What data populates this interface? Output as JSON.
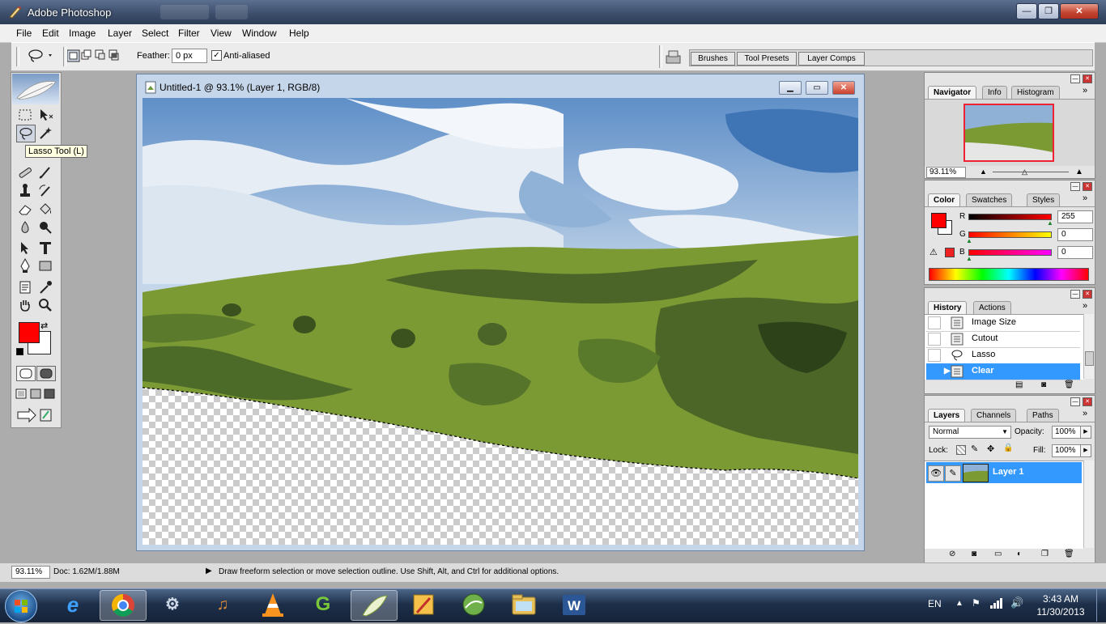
{
  "window": {
    "title": "Adobe Photoshop",
    "buttons": {
      "minimize": "—",
      "restore": "❐",
      "close": "✕"
    }
  },
  "menu": [
    "File",
    "Edit",
    "Image",
    "Layer",
    "Select",
    "Filter",
    "View",
    "Window",
    "Help"
  ],
  "options": {
    "feather_label": "Feather:",
    "feather_value": "0 px",
    "antialiased_label": "Anti-aliased",
    "antialiased_checked": true,
    "dock_tabs": [
      "Brushes",
      "Tool Presets",
      "Layer Comps"
    ]
  },
  "toolbox": {
    "tooltip": "Lasso Tool (L)",
    "foreground_color": "#ff0000",
    "background_color": "#ffffff"
  },
  "document": {
    "title": "Untitled-1 @ 93.1% (Layer 1, RGB/8)"
  },
  "navigator": {
    "tabs": [
      "Navigator",
      "Info",
      "Histogram"
    ],
    "zoom": "93.11%"
  },
  "color_panel": {
    "tabs": [
      "Color",
      "Swatches",
      "Styles"
    ],
    "channels": [
      {
        "label": "R",
        "value": "255"
      },
      {
        "label": "G",
        "value": "0"
      },
      {
        "label": "B",
        "value": "0"
      }
    ]
  },
  "history": {
    "tabs": [
      "History",
      "Actions"
    ],
    "items": [
      "Image Size",
      "Cutout",
      "Lasso",
      "Clear"
    ],
    "selected": "Clear"
  },
  "layers": {
    "tabs": [
      "Layers",
      "Channels",
      "Paths"
    ],
    "blend_mode": "Normal",
    "opacity_label": "Opacity:",
    "opacity": "100%",
    "lock_label": "Lock:",
    "fill_label": "Fill:",
    "fill": "100%",
    "layer_name": "Layer 1"
  },
  "status": {
    "zoom": "93.11%",
    "doc": "Doc: 1.62M/1.88M",
    "message": "Draw freeform selection or move selection outline.  Use Shift, Alt, and Ctrl for additional options."
  },
  "taskbar": {
    "language": "EN",
    "time": "3:43 AM",
    "date": "11/30/2013"
  },
  "colors": {
    "accent_selection": "#3399ff",
    "titlebar": "#3d4f6d"
  }
}
